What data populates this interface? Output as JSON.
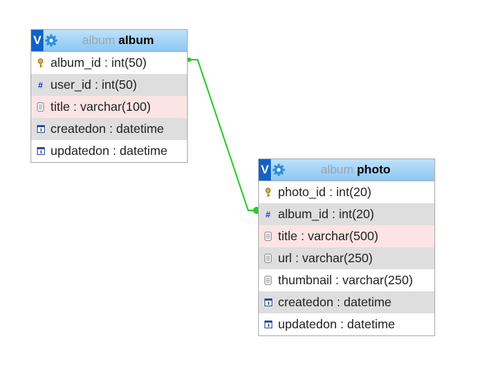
{
  "tables": [
    {
      "schema": "album",
      "name": "album",
      "columns": [
        {
          "text": "album_id : int(50)",
          "icon": "primary-key-icon",
          "bg": "plain"
        },
        {
          "text": "user_id : int(50)",
          "icon": "number-icon",
          "bg": "shade"
        },
        {
          "text": "title : varchar(100)",
          "icon": "text-icon",
          "bg": "pink"
        },
        {
          "text": "createdon : datetime",
          "icon": "date-icon",
          "bg": "shade"
        },
        {
          "text": "updatedon : datetime",
          "icon": "date-icon",
          "bg": "plain"
        }
      ]
    },
    {
      "schema": "album",
      "name": "photo",
      "columns": [
        {
          "text": "photo_id : int(20)",
          "icon": "primary-key-icon",
          "bg": "plain"
        },
        {
          "text": "album_id : int(20)",
          "icon": "number-icon",
          "bg": "shade"
        },
        {
          "text": "title : varchar(500)",
          "icon": "text-icon",
          "bg": "pink"
        },
        {
          "text": "url : varchar(250)",
          "icon": "text-icon",
          "bg": "shade"
        },
        {
          "text": "thumbnail : varchar(250)",
          "icon": "text-icon",
          "bg": "plain"
        },
        {
          "text": "createdon : datetime",
          "icon": "date-icon",
          "bg": "shade"
        },
        {
          "text": "updatedon : datetime",
          "icon": "date-icon",
          "bg": "plain"
        }
      ]
    }
  ],
  "header_toggle_label": "V",
  "relations": [
    {
      "from_table": "album",
      "from_column": "album_id",
      "to_table": "photo",
      "to_column": "album_id",
      "color": "#22cc22"
    }
  ],
  "colors": {
    "header_gradient": "#a2d3f6",
    "toggle_blue": "#1261c9",
    "row_shade": "#dedede",
    "row_pink": "#fde4e4",
    "relation_line": "#22cc22"
  }
}
